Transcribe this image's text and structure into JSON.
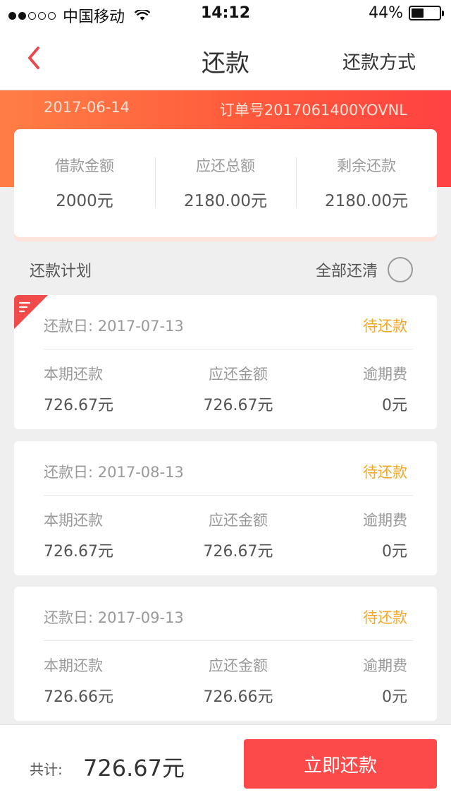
{
  "status_bar": {
    "carrier": "中国移动",
    "time": "14:12",
    "battery": "44%",
    "battery_level": 0.44
  },
  "nav": {
    "title": "还款",
    "right_label": "还款方式"
  },
  "order": {
    "date": "2017-06-14",
    "order_no": "订单号2017061400YOVNL"
  },
  "summary": [
    {
      "label": "借款金额",
      "value": "2000元"
    },
    {
      "label": "应还总额",
      "value": "2180.00元"
    },
    {
      "label": "剩余还款",
      "value": "2180.00元"
    }
  ],
  "plan": {
    "title": "还款计划",
    "pay_all_label": "全部还清"
  },
  "installments": [
    {
      "date": "还款日: 2017-07-13",
      "status": "待还款",
      "col1_label": "本期还款",
      "col1_value": "726.67元",
      "col2_label": "应还金额",
      "col2_value": "726.67元",
      "col3_label": "逾期费",
      "col3_value": "0元"
    },
    {
      "date": "还款日: 2017-08-13",
      "status": "待还款",
      "col1_label": "本期还款",
      "col1_value": "726.67元",
      "col2_label": "应还金额",
      "col2_value": "726.67元",
      "col3_label": "逾期费",
      "col3_value": "0元"
    },
    {
      "date": "还款日: 2017-09-13",
      "status": "待还款",
      "col1_label": "本期还款",
      "col1_value": "726.66元",
      "col2_label": "应还金额",
      "col2_value": "726.66元",
      "col3_label": "逾期费",
      "col3_value": "0元"
    }
  ],
  "footer": {
    "total_label": "共计:",
    "total_value": "726.67元",
    "pay_button": "立即还款"
  },
  "colors": {
    "accent": "#fc4a4a",
    "status_pending": "#f5a623",
    "hero_start": "#ff7e45",
    "hero_end": "#ff4242"
  }
}
